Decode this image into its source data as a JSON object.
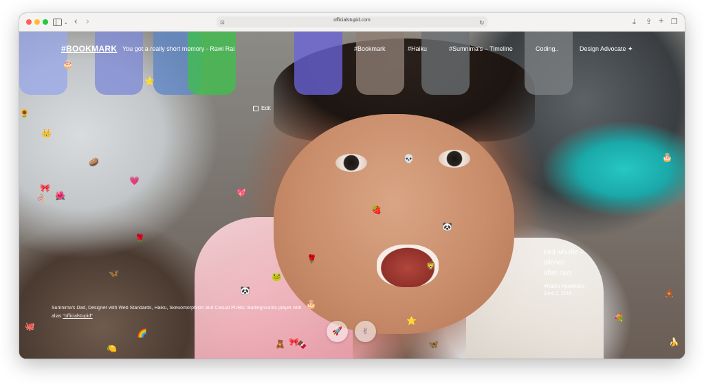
{
  "browser": {
    "url": "officialstupid.com",
    "nav_back_glyph": "‹",
    "nav_forward_glyph": "›",
    "reload_glyph": "↻",
    "download_glyph": "⤓",
    "share_glyph": "⇪",
    "new_tab_glyph": "+",
    "tabs_glyph": "❐",
    "dropdown_glyph": "⌄",
    "site_icon_glyph": "⊡"
  },
  "site": {
    "logo": "#BOOKMARK",
    "tagline": "You got a really short memory - Rawi Rai",
    "nav": [
      {
        "label": "#Bookmark"
      },
      {
        "label": "#Haiku"
      },
      {
        "label": "#Sumnima's – Timeline"
      },
      {
        "label": "Coding.."
      },
      {
        "label": "Design Advocate ✦"
      }
    ],
    "edit_label": "Edit",
    "haiku_lines": [
      "bird whistle –",
      "silence",
      "after rain"
    ],
    "haiku_tags": "#haiku #pokhara",
    "haiku_date": "June 2, 2018",
    "bio_line1": "Sumnima's Dad, Designer with Web Standards, Haiku, Skeuomorphism and Casual PUBG: Battlegrounds player with",
    "bio_line2_prefix": "alias ",
    "bio_link": "\"officialstupid\"",
    "prev_button_glyph": "🚀",
    "next_button_glyph": "✌"
  },
  "colors": {
    "swatches": [
      "#9aa8e8",
      "#7f8ad6",
      "#5f86c8",
      "#3fbf4b",
      "#6a64d8",
      "#8f7f75",
      "#6b6f73",
      "#7c7f82"
    ]
  },
  "emojis": [
    {
      "glyph": "🎂"
    },
    {
      "glyph": "⭐"
    },
    {
      "glyph": "🌻"
    },
    {
      "glyph": "👑"
    },
    {
      "glyph": "🥔"
    },
    {
      "glyph": "🎀"
    },
    {
      "glyph": "🍭"
    },
    {
      "glyph": "🌺"
    },
    {
      "glyph": "💗"
    },
    {
      "glyph": "💖"
    },
    {
      "glyph": "🌹"
    },
    {
      "glyph": "🦋"
    },
    {
      "glyph": "🐸"
    },
    {
      "glyph": "🐼"
    },
    {
      "glyph": "🌹"
    },
    {
      "glyph": "🦁"
    },
    {
      "glyph": "🐼"
    },
    {
      "glyph": "💀"
    },
    {
      "glyph": "🍓"
    },
    {
      "glyph": "🧸"
    },
    {
      "glyph": "🎂"
    },
    {
      "glyph": "💐"
    },
    {
      "glyph": "🍌"
    },
    {
      "glyph": "🦋"
    },
    {
      "glyph": "⭐"
    },
    {
      "glyph": "🎀"
    },
    {
      "glyph": "🧸"
    },
    {
      "glyph": "🌈"
    },
    {
      "glyph": "🍋"
    },
    {
      "glyph": "🐙"
    },
    {
      "glyph": "🎂"
    },
    {
      "glyph": "🍫"
    }
  ]
}
